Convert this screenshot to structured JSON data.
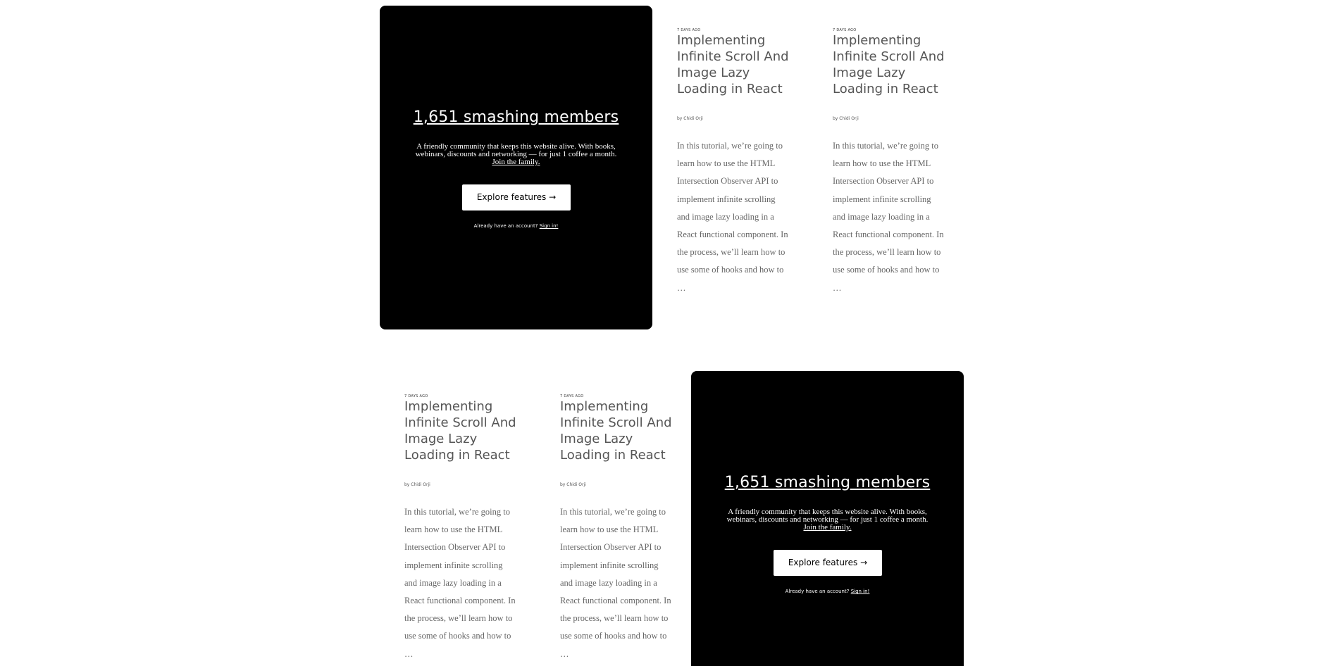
{
  "promo": {
    "title": "1,651 smashing members",
    "description": "A friendly community that keeps this website alive. With books, webinars, discounts and networking — for just 1 coffee a month.",
    "join_link": "Join the family.",
    "button_label": "Explore features →",
    "signin_text": "Already have an account?",
    "signin_link": "Sign in!"
  },
  "articles": [
    {
      "date": "7 DAYS AGO",
      "title": "Implementing Infinite Scroll And Image Lazy Loading in React",
      "author": "by Chidi Orji",
      "excerpt": "In this tutorial, we’re going to learn how to use the HTML Intersection Observer API to implement infinite scrolling and image lazy loading in a React functional component. In the process, we’ll learn how to use some of hooks and how to …"
    },
    {
      "date": "7 DAYS AGO",
      "title": "Implementing Infinite Scroll And Image Lazy Loading in React",
      "author": "by Chidi Orji",
      "excerpt": "In this tutorial, we’re going to learn how to use the HTML Intersection Observer API to implement infinite scrolling and image lazy loading in a React functional component. In the process, we’ll learn how to use some of hooks and how to …"
    },
    {
      "date": "7 DAYS AGO",
      "title": "Implementing Infinite Scroll And Image Lazy Loading in React",
      "author": "by Chidi Orji",
      "excerpt": "In this tutorial, we’re going to learn how to use the HTML Intersection Observer API to implement infinite scrolling and image lazy loading in a React functional component. In the process, we’ll learn how to use some of hooks and how to …"
    },
    {
      "date": "7 DAYS AGO",
      "title": "Implementing Infinite Scroll And Image Lazy Loading in React",
      "author": "by Chidi Orji",
      "excerpt": "In this tutorial, we’re going to learn how to use the HTML Intersection Observer API to implement infinite scrolling and image lazy loading in a React functional component. In the process, we’ll learn how to use some of hooks and how to …"
    }
  ]
}
